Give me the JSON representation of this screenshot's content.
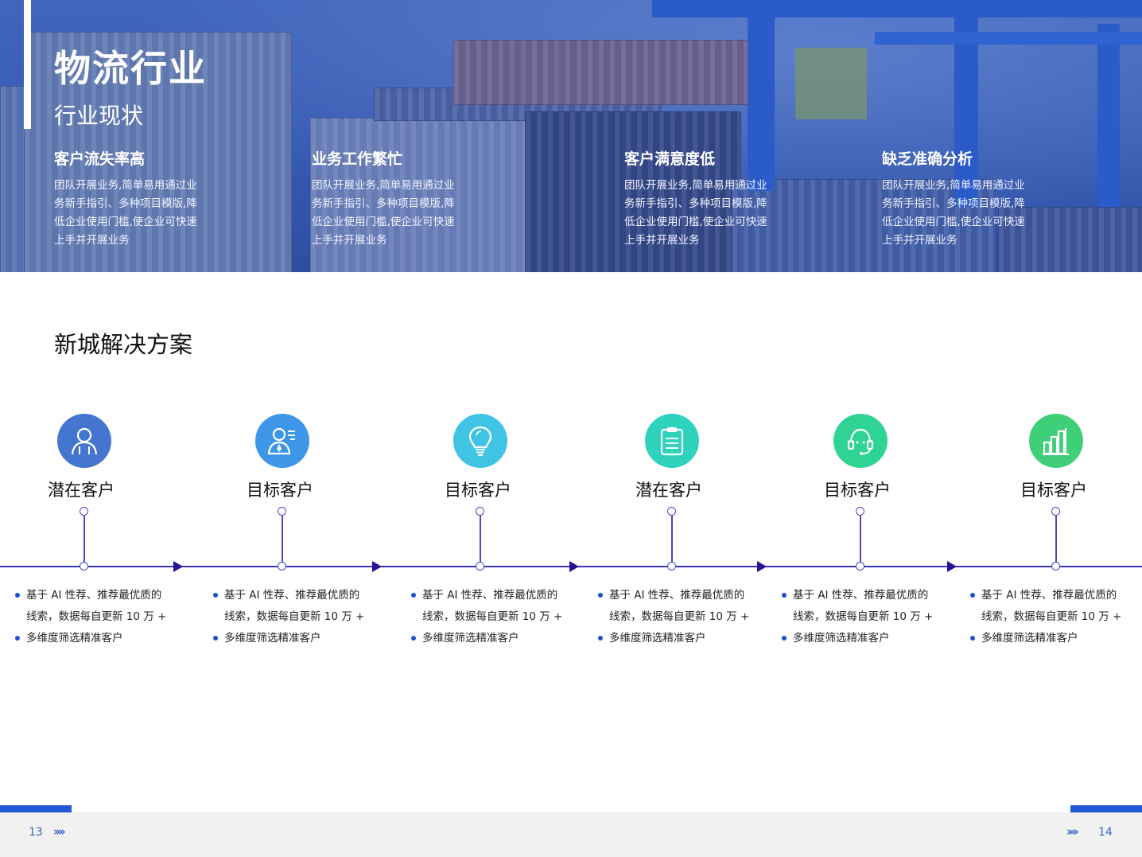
{
  "hero": {
    "title": "物流行业",
    "subtitle": "行业现状",
    "features": [
      {
        "title": "客户流失率高",
        "text": "团队开展业务,简单易用通过业务新手指引、多种项目模版,降低企业使用门槛,使企业可快速上手并开展业务"
      },
      {
        "title": "业务工作繁忙",
        "text": "团队开展业务,简单易用通过业务新手指引、多种项目模版,降低企业使用门槛,使企业可快速上手并开展业务"
      },
      {
        "title": "客户满意度低",
        "text": "团队开展业务,简单易用通过业务新手指引、多种项目模版,降低企业使用门槛,使企业可快速上手并开展业务"
      },
      {
        "title": "缺乏准确分析",
        "text": "团队开展业务,简单易用通过业务新手指引、多种项目模版,降低企业使用门槛,使企业可快速上手并开展业务"
      }
    ]
  },
  "solutions": {
    "title": "新城解决方案",
    "steps": [
      {
        "label": "潜在客户",
        "icon": "user-icon",
        "color": "#4476cf",
        "b1a": "基于 AI 性荐、推荐最优质的",
        "b1b": "线索，数据每自更新 10 万 +",
        "b2": "多维度筛选精准客户"
      },
      {
        "label": "目标客户",
        "icon": "agent-icon",
        "color": "#3d96e8",
        "b1a": "基于 AI 性荐、推荐最优质的",
        "b1b": "线索，数据每自更新 10 万 +",
        "b2": "多维度筛选精准客户"
      },
      {
        "label": "目标客户",
        "icon": "lightbulb-icon",
        "color": "#3fc4e4",
        "b1a": "基于 AI 性荐、推荐最优质的",
        "b1b": "线索，数据每自更新 10 万 +",
        "b2": "多维度筛选精准客户"
      },
      {
        "label": "潜在客户",
        "icon": "clipboard-icon",
        "color": "#2fd3bd",
        "b1a": "基于 AI 性荐、推荐最优质的",
        "b1b": "线索，数据每自更新 10 万 +",
        "b2": "多维度筛选精准客户"
      },
      {
        "label": "目标客户",
        "icon": "headset-icon",
        "color": "#2fd495",
        "b1a": "基于 AI 性荐、推荐最优质的",
        "b1b": "线索，数据每自更新 10 万 +",
        "b2": "多维度筛选精准客户"
      },
      {
        "label": "目标客户",
        "icon": "bar-chart-icon",
        "color": "#3ecf78",
        "b1a": "基于 AI 性荐、推荐最优质的",
        "b1b": "线索，数据每自更新 10 万 +",
        "b2": "多维度筛选精准客户"
      }
    ]
  },
  "footer": {
    "left_page": "13",
    "right_page": "14",
    "left_chevrons": "››››",
    "right_chevrons": "››››"
  }
}
